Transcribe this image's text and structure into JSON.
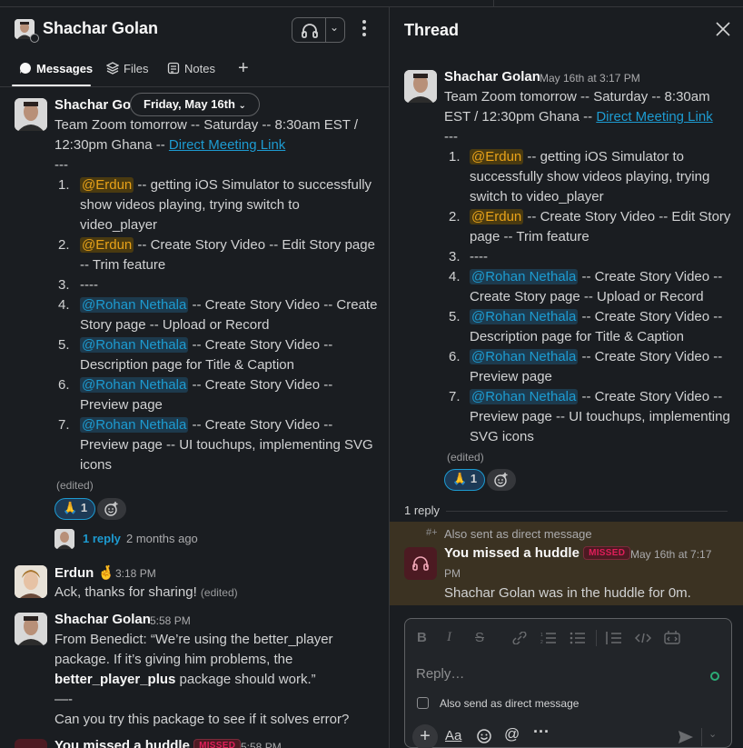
{
  "channel": {
    "title": "Shachar Golan",
    "more_label": "⋮"
  },
  "tabs": [
    {
      "label": "Messages"
    },
    {
      "label": "Files"
    },
    {
      "label": "Notes"
    }
  ],
  "tab_add": "+",
  "date_pill": "Friday, May 16th",
  "left_messages": {
    "m1": {
      "sender": "Shachar Golan",
      "line1": "Team Zoom tomorrow -- Saturday -- 8:30am EST /",
      "line2_pre": "12:30pm Ghana -- ",
      "link": "Direct Meeting Link",
      "sep": "---",
      "items": [
        {
          "n": "1.",
          "mention": "@Erdun",
          "t1": " -- getting iOS Simulator to successfully",
          "t2": "show videos playing, trying switch to",
          "t3": "video_player"
        },
        {
          "n": "2.",
          "mention": "@Erdun",
          "t1": " -- Create Story Video -- Edit Story page",
          "t2": "-- Trim feature"
        },
        {
          "n": "3.",
          "text": "----"
        },
        {
          "n": "4.",
          "mention": "@Rohan Nethala",
          "t1": " -- Create Story Video -- Create",
          "t2": "Story page -- Upload or Record"
        },
        {
          "n": "5.",
          "mention": "@Rohan Nethala",
          "t1": " -- Create Story Video --",
          "t2": "Description page for Title & Caption"
        },
        {
          "n": "6.",
          "mention": "@Rohan Nethala",
          "t1": " -- Create Story Video --",
          "t2": "Preview page"
        },
        {
          "n": "7.",
          "mention": "@Rohan Nethala",
          "t1": " -- Create Story Video --",
          "t2": "Preview page -- UI touchups, implementing SVG",
          "t3": "icons"
        }
      ],
      "edited": "(edited)",
      "reaction_count": "1",
      "reply_link": "1 reply",
      "reply_age": "2 months ago"
    },
    "m2": {
      "sender": "Erdun",
      "emoji": "🤞",
      "time": "3:18 PM",
      "text": "Ack, thanks for sharing!",
      "edited": "(edited)"
    },
    "m3": {
      "sender": "Shachar Golan",
      "time": "5:58 PM",
      "l1": "From Benedict: “We’re using the better_player",
      "l2": "package. If it’s giving him problems, the",
      "l3_bold": "better_player_plus",
      "l3_rest": " package should work.”",
      "l4": "—-",
      "l5": "Can you try this package to see if it solves error?"
    },
    "m4": {
      "sender": "You missed a huddle",
      "badge": "MISSED",
      "time": "5:58 PM"
    }
  },
  "thread": {
    "title": "Thread",
    "parent": {
      "sender": "Shachar Golan",
      "time": "May 16th at 3:17 PM",
      "line1": "Team Zoom tomorrow -- Saturday -- 8:30am",
      "line2_pre": "EST / 12:30pm Ghana -- ",
      "link": "Direct Meeting Link",
      "sep": "---",
      "items": [
        {
          "n": "1.",
          "mention": "@Erdun",
          "t1": " -- getting iOS Simulator to",
          "t2": "successfully show videos playing, trying",
          "t3": "switch to video_player"
        },
        {
          "n": "2.",
          "mention": "@Erdun",
          "t1": " -- Create Story Video -- Edit Story",
          "t2": "page -- Trim feature"
        },
        {
          "n": "3.",
          "text": "----"
        },
        {
          "n": "4.",
          "mention": "@Rohan Nethala",
          "t1": " -- Create Story Video --",
          "t2": "Create Story page -- Upload or Record"
        },
        {
          "n": "5.",
          "mention": "@Rohan Nethala",
          "t1": " -- Create Story Video --",
          "t2": "Description page for Title & Caption"
        },
        {
          "n": "6.",
          "mention": "@Rohan Nethala",
          "t1": " -- Create Story Video --",
          "t2": "Preview page"
        },
        {
          "n": "7.",
          "mention": "@Rohan Nethala",
          "t1": " -- Create Story Video --",
          "t2": "Preview page -- UI touchups, implementing",
          "t3": "SVG icons"
        }
      ],
      "edited": "(edited)",
      "reaction_count": "1"
    },
    "replies_count": "1 reply",
    "reply": {
      "also_sent": "Also sent as direct message",
      "sender": "You missed a huddle",
      "badge": "MISSED",
      "time1": "May 16th at 7:17",
      "time2": "PM",
      "text": "Shachar Golan was in the huddle for 0m."
    }
  },
  "composer": {
    "placeholder": "Reply…",
    "also_send_label": "Also send as direct message",
    "format_label": "Aa"
  },
  "colors": {
    "mention_yellow": "#e8a219",
    "mention_blue": "#1d9bd1",
    "missed_bg": "#3b3222",
    "missed_badge": "#e01e5a"
  }
}
